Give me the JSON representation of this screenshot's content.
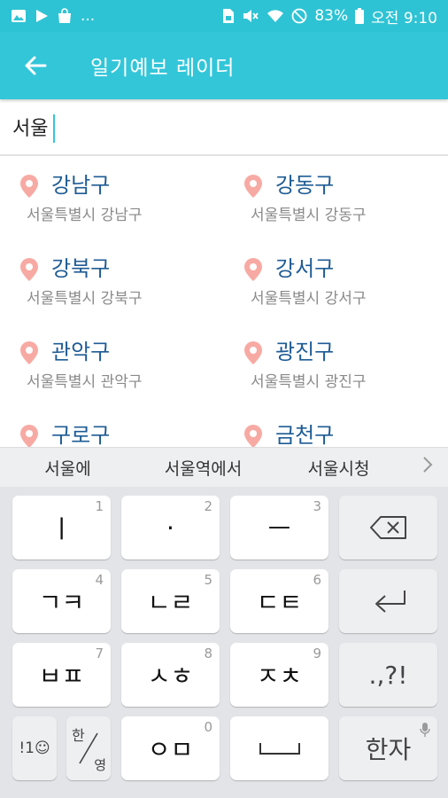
{
  "status_bar": {
    "battery": "83%",
    "time": "오전 9:10",
    "icons": [
      "image-icon",
      "play-store-icon",
      "bag-icon",
      "more-dots-icon",
      "sim-icon",
      "mute-icon",
      "wifi-icon",
      "do-not-disturb-icon",
      "battery-icon"
    ],
    "more_text": "..."
  },
  "app_bar": {
    "title": "일기예보 레이더",
    "accent": "#33c6d9"
  },
  "search": {
    "value": "서울"
  },
  "results": [
    {
      "name": "강남구",
      "sub": "서울특별시 강남구"
    },
    {
      "name": "강동구",
      "sub": "서울특별시 강동구"
    },
    {
      "name": "강북구",
      "sub": "서울특별시 강북구"
    },
    {
      "name": "강서구",
      "sub": "서울특별시 강서구"
    },
    {
      "name": "관악구",
      "sub": "서울특별시 관악구"
    },
    {
      "name": "광진구",
      "sub": "서울특별시 광진구"
    },
    {
      "name": "구로구",
      "sub": ""
    },
    {
      "name": "금천구",
      "sub": ""
    }
  ],
  "suggestions": [
    "서울에",
    "서울역에서",
    "서울시청"
  ],
  "keyboard": {
    "keys": [
      {
        "label": "ㅣ",
        "num": "1"
      },
      {
        "label": "·",
        "num": "2"
      },
      {
        "label": "ㅡ",
        "num": "3"
      },
      {
        "label": "ㄱㅋ",
        "num": "4"
      },
      {
        "label": "ㄴㄹ",
        "num": "5"
      },
      {
        "label": "ㄷㅌ",
        "num": "6"
      },
      {
        "label": "ㅂㅍ",
        "num": "7"
      },
      {
        "label": "ㅅㅎ",
        "num": "8"
      },
      {
        "label": "ㅈㅊ",
        "num": "9"
      },
      {
        "label": "ㅇㅁ",
        "num": "0"
      }
    ],
    "punct_label": ".,?!",
    "symbol_label": "!1☺",
    "lang_top": "한",
    "lang_bottom": "영",
    "hanja_label": "한자"
  }
}
